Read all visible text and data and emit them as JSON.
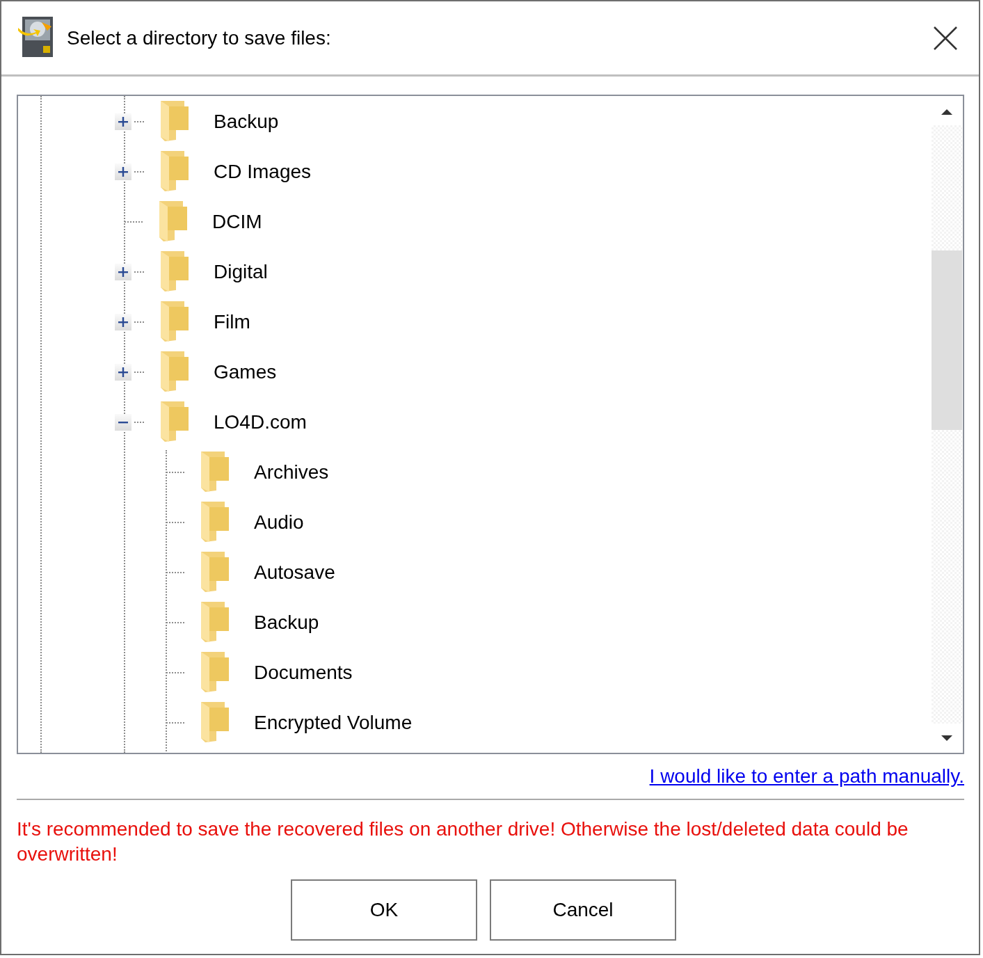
{
  "window": {
    "title": "Select a directory to save files:"
  },
  "tree": [
    {
      "label": "Backup",
      "expanded": false
    },
    {
      "label": "CD Images",
      "expanded": false
    },
    {
      "label": "DCIM"
    },
    {
      "label": "Digital",
      "expanded": false
    },
    {
      "label": "Film",
      "expanded": false
    },
    {
      "label": "Games",
      "expanded": false
    },
    {
      "label": "LO4D.com",
      "expanded": true,
      "children": [
        {
          "label": "Archives"
        },
        {
          "label": "Audio"
        },
        {
          "label": "Autosave"
        },
        {
          "label": "Backup"
        },
        {
          "label": "Documents"
        },
        {
          "label": "Encrypted Volume"
        }
      ]
    }
  ],
  "manual_path_link": "I would like to enter a path manually.",
  "warning": "It's recommended to save the recovered files on another drive! Otherwise the lost/deleted data could be overwritten!",
  "buttons": [
    "OK",
    "Cancel"
  ]
}
